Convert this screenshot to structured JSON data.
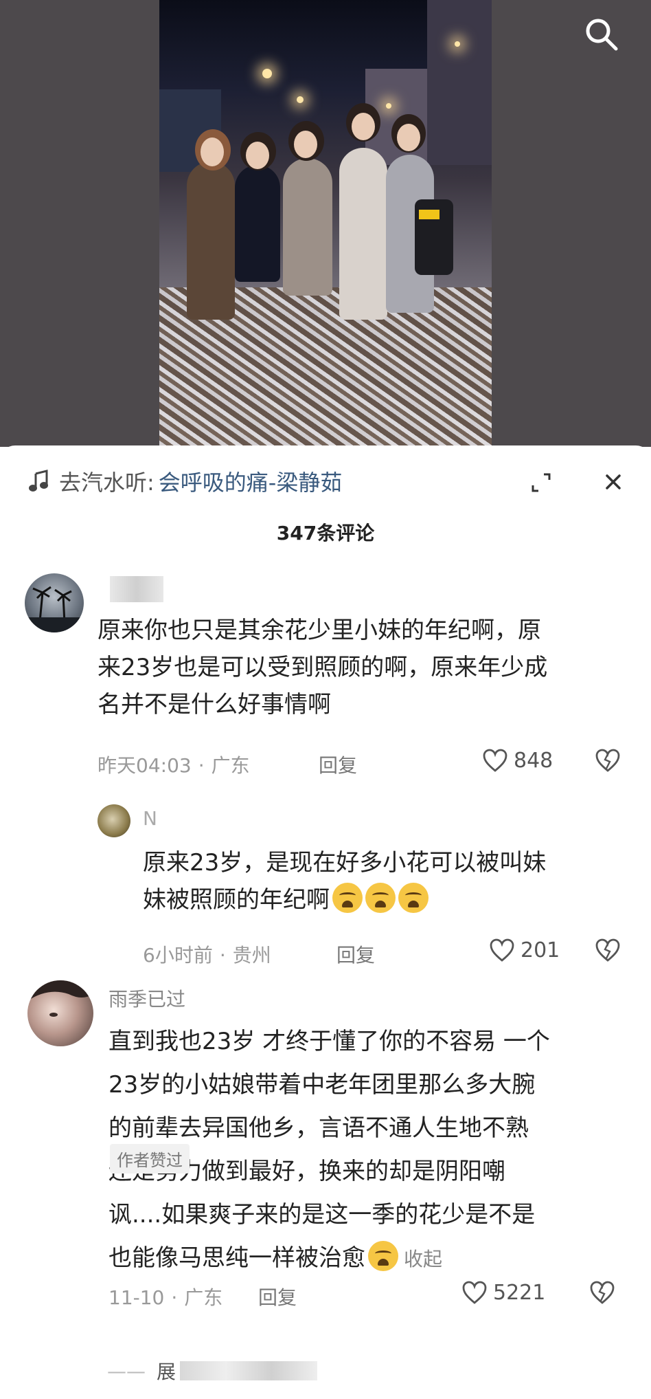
{
  "header": {
    "search_icon": "search-icon"
  },
  "music": {
    "prefix": "去汽水听:",
    "song": "会呼吸的痛-梁静茹",
    "icon": "music-note-icon"
  },
  "comments_header": {
    "count_label": "347条评论"
  },
  "comments": [
    {
      "username": "",
      "text_lines": [
        "原来你也只是其余花少里小妹的年纪啊，原",
        "来23岁也是可以受到照顾的啊，原来年少成",
        "名并不是什么好事情啊"
      ],
      "time": "昨天04:03",
      "location": "广东",
      "reply_label": "回复",
      "likes": "848"
    },
    {
      "username": "N",
      "text_lines": [
        "原来23岁，是现在好多小花可以被叫妹",
        "妹被照顾的年纪啊"
      ],
      "time": "6小时前",
      "location": "贵州",
      "reply_label": "回复",
      "likes": "201"
    },
    {
      "username": "雨季已过",
      "text_lines": [
        "直到我也23岁 才终于懂了你的不容易 一个",
        "23岁的小姑娘带着中老年团里那么多大腕",
        "的前辈去异国他乡，言语不通人生地不熟",
        "还是努力做到最好，换来的却是阴阳嘲",
        "讽....如果爽子来的是这一季的花少是不是",
        "也能像马思纯一样被治愈"
      ],
      "collapse_label": "收起",
      "time": "11-10",
      "location": "广东",
      "reply_label": "回复",
      "likes": "5221",
      "badge": "作者赞过"
    }
  ],
  "more_replies": {
    "dash": "——",
    "label": "展"
  }
}
